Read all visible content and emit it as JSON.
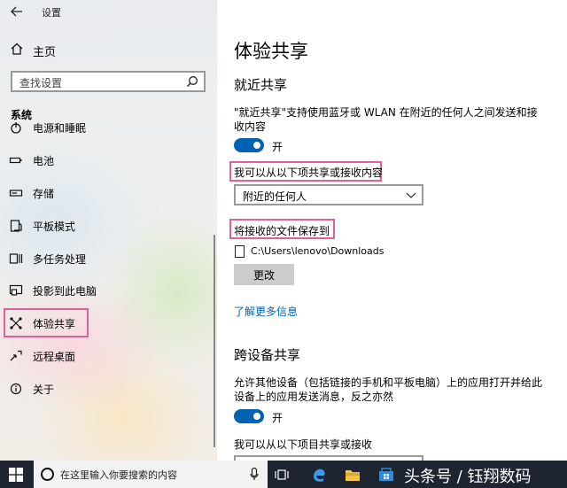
{
  "window": {
    "title": "设置"
  },
  "sidebar": {
    "home_label": "主页",
    "search_placeholder": "查找设置",
    "section": "系统",
    "items": [
      {
        "label": "电源和睡眠",
        "icon": "power-icon"
      },
      {
        "label": "电池",
        "icon": "battery-icon"
      },
      {
        "label": "存储",
        "icon": "storage-icon"
      },
      {
        "label": "平板模式",
        "icon": "tablet-mode-icon"
      },
      {
        "label": "多任务处理",
        "icon": "multitasking-icon"
      },
      {
        "label": "投影到此电脑",
        "icon": "project-icon"
      },
      {
        "label": "体验共享",
        "icon": "shared-experiences-icon",
        "active": true
      },
      {
        "label": "远程桌面",
        "icon": "remote-desktop-icon"
      },
      {
        "label": "关于",
        "icon": "info-icon"
      }
    ]
  },
  "main": {
    "page_title": "体验共享",
    "nearby": {
      "heading": "就近共享",
      "description": "\"就近共享\"支持使用蓝牙或 WLAN 在附近的任何人之间发送和接收内容",
      "toggle_label": "开",
      "toggle_on": true,
      "share_from_label": "我可以从以下项共享或接收内容",
      "share_from_value": "附近的任何人",
      "save_to_label": "将接收的文件保存到",
      "save_path": "C:\\Users\\lenovo\\Downloads",
      "change_button": "更改",
      "learn_more": "了解更多信息"
    },
    "cross_device": {
      "heading": "跨设备共享",
      "description": "允许其他设备（包括链接的手机和平板电脑）上的应用打开并给此设备上的应用发送消息，反之亦然",
      "toggle_label": "开",
      "toggle_on": true,
      "share_from_label": "我可以从以下项目共享或接收"
    }
  },
  "taskbar": {
    "search_placeholder": "在这里输入你要搜索的内容",
    "watermark": "头条号 / 钰翔数码"
  },
  "colors": {
    "accent": "#0063b1",
    "highlight_box": "#e0609c",
    "taskbar_bg": "#1f2530"
  }
}
